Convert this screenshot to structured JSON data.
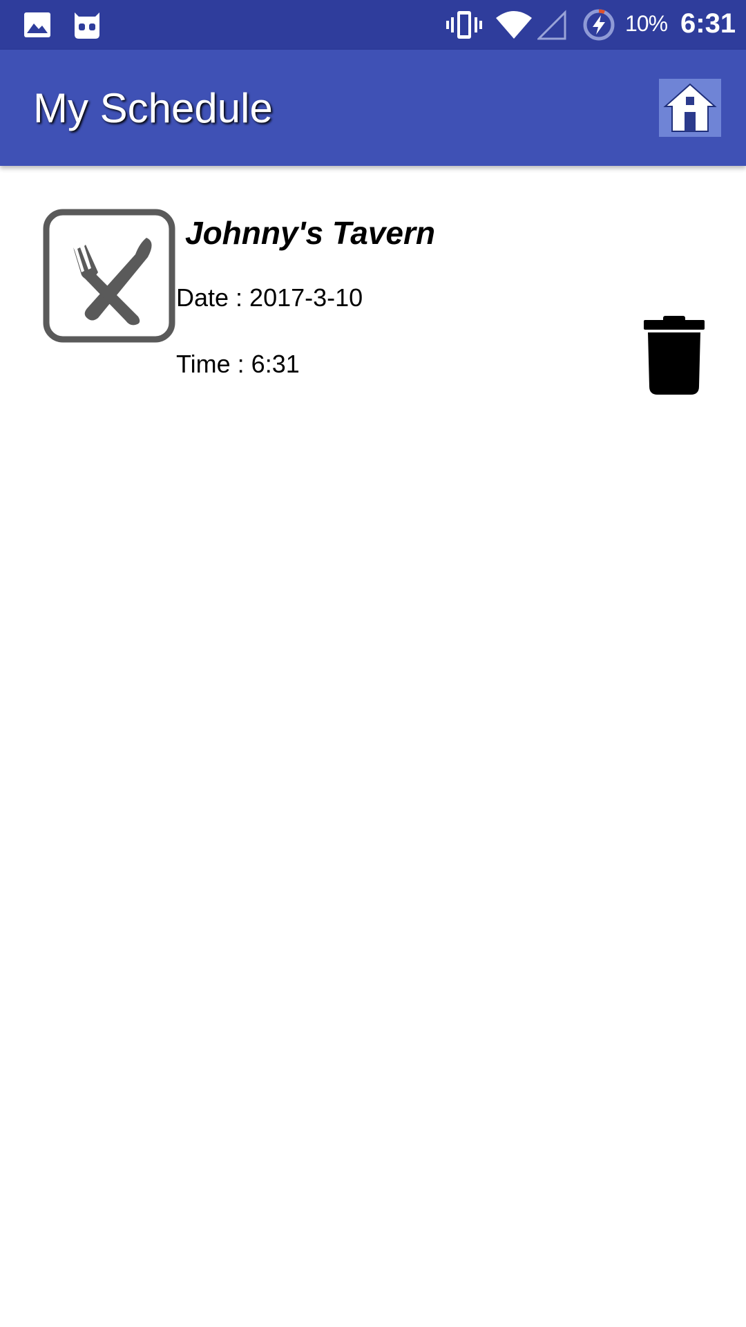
{
  "status_bar": {
    "icons": [
      "image-icon",
      "cyanogen-icon",
      "vibrate-icon",
      "wifi-icon",
      "cell-signal-icon",
      "battery-charging-icon"
    ],
    "battery_percent": "10%",
    "time": "6:31"
  },
  "app_bar": {
    "title": "My Schedule",
    "home_icon": "home-icon",
    "colors": {
      "primary": "#3f51b5",
      "primary_dark": "#2f3d9c"
    }
  },
  "schedule": {
    "items": [
      {
        "category_icon": "fork-knife-icon",
        "name": "Johnny's Tavern",
        "date": "Date : 2017-3-10",
        "time": "Time : 6:31",
        "delete_icon": "trash-icon"
      }
    ]
  }
}
